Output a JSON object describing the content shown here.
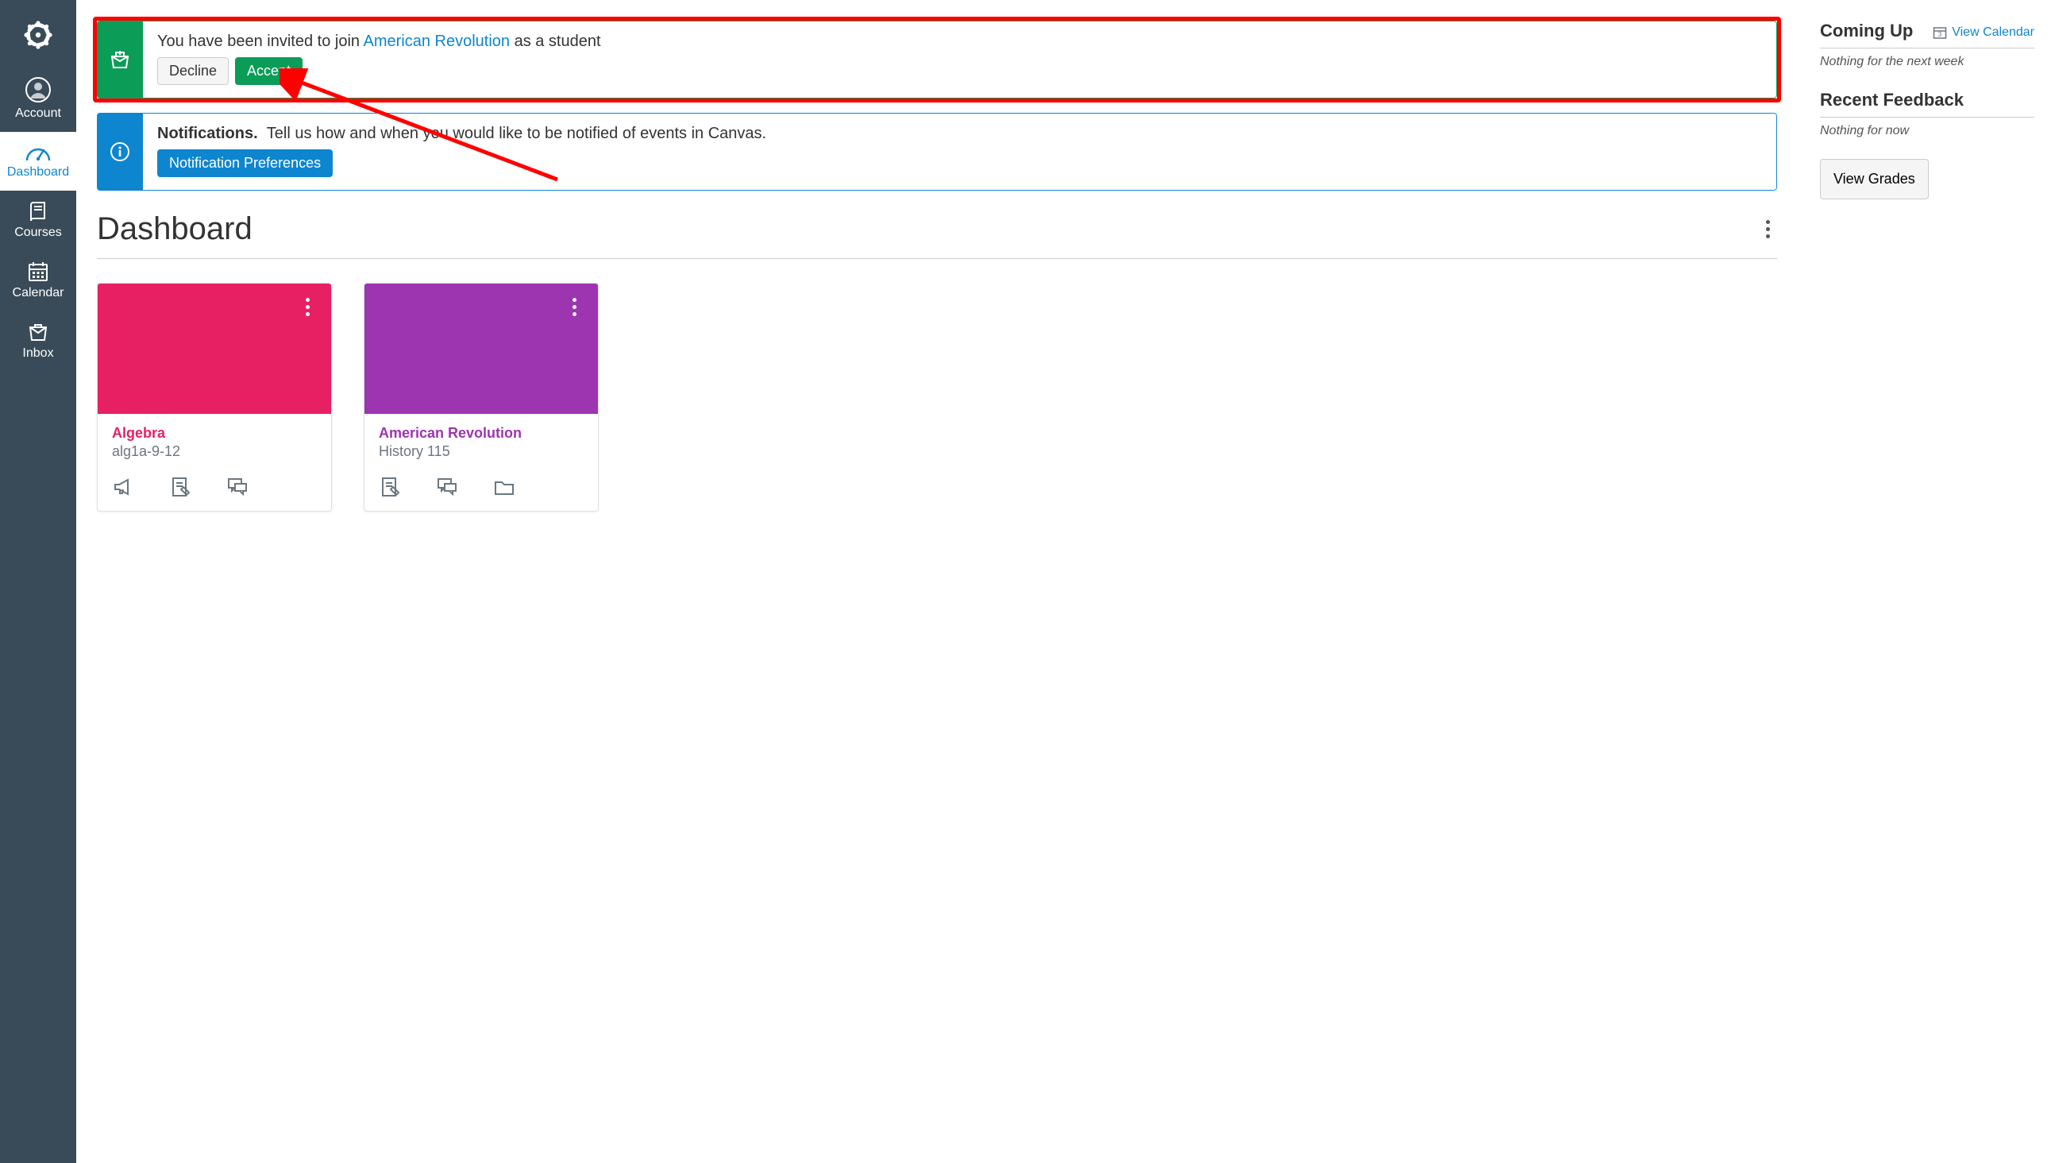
{
  "nav": {
    "items": [
      {
        "key": "account",
        "label": "Account"
      },
      {
        "key": "dashboard",
        "label": "Dashboard"
      },
      {
        "key": "courses",
        "label": "Courses"
      },
      {
        "key": "calendar",
        "label": "Calendar"
      },
      {
        "key": "inbox",
        "label": "Inbox"
      }
    ]
  },
  "invite": {
    "prefix": "You have been invited to join ",
    "course": "American Revolution",
    "suffix": " as a student",
    "decline": "Decline",
    "accept": "Accept"
  },
  "notify": {
    "title": "Notifications.",
    "body": "Tell us how and when you would like to be notified of events in Canvas.",
    "button": "Notification Preferences"
  },
  "page_title": "Dashboard",
  "cards": [
    {
      "title": "Algebra",
      "subtitle": "alg1a-9-12",
      "color": "#E71F63",
      "text_color": "#E71F63",
      "icons": [
        "announcement",
        "assignment",
        "discussion"
      ]
    },
    {
      "title": "American Revolution",
      "subtitle": "History 115",
      "color": "#9D34B0",
      "text_color": "#9D34B0",
      "icons": [
        "assignment",
        "discussion",
        "files"
      ]
    }
  ],
  "sidebar": {
    "coming_up": {
      "title": "Coming Up",
      "link": "View Calendar",
      "empty": "Nothing for the next week"
    },
    "feedback": {
      "title": "Recent Feedback",
      "empty": "Nothing for now"
    },
    "grades_button": "View Grades"
  }
}
